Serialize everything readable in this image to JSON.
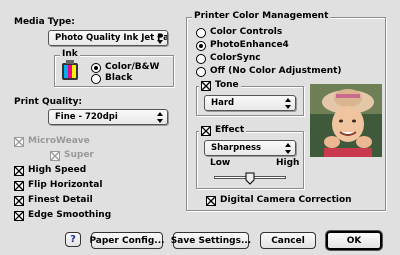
{
  "media_type": {
    "label": "Media Type:",
    "value": "Photo Quality Ink Jet Pa..."
  },
  "ink": {
    "label": "Ink",
    "options": [
      "Color/B&W",
      "Black"
    ],
    "selected": "Color/B&W"
  },
  "print_quality": {
    "label": "Print Quality:",
    "value": "Fine - 720dpi"
  },
  "options": {
    "microweave": {
      "label": "MicroWeave",
      "checked": true,
      "enabled": false
    },
    "super": {
      "label": "Super",
      "checked": true,
      "enabled": false
    },
    "high_speed": {
      "label": "High Speed",
      "checked": true
    },
    "flip_horizontal": {
      "label": "Flip Horizontal",
      "checked": true
    },
    "finest_detail": {
      "label": "Finest Detail",
      "checked": true
    },
    "edge_smoothing": {
      "label": "Edge Smoothing",
      "checked": true
    }
  },
  "color_management": {
    "title": "Printer Color Management",
    "options": [
      "Color Controls",
      "PhotoEnhance4",
      "ColorSync",
      "Off (No Color Adjustment)"
    ],
    "selected": "PhotoEnhance4"
  },
  "tone": {
    "label": "Tone",
    "checked": true,
    "value": "Hard"
  },
  "effect": {
    "label": "Effect",
    "checked": true,
    "value": "Sharpness",
    "slider_low": "Low",
    "slider_high": "High",
    "slider_level": 0.5
  },
  "digital_camera": {
    "label": "Digital Camera Correction",
    "checked": true
  },
  "buttons": {
    "help": "?",
    "paper_config": "Paper Config...",
    "save_settings": "Save Settings...",
    "cancel": "Cancel",
    "ok": "OK"
  }
}
